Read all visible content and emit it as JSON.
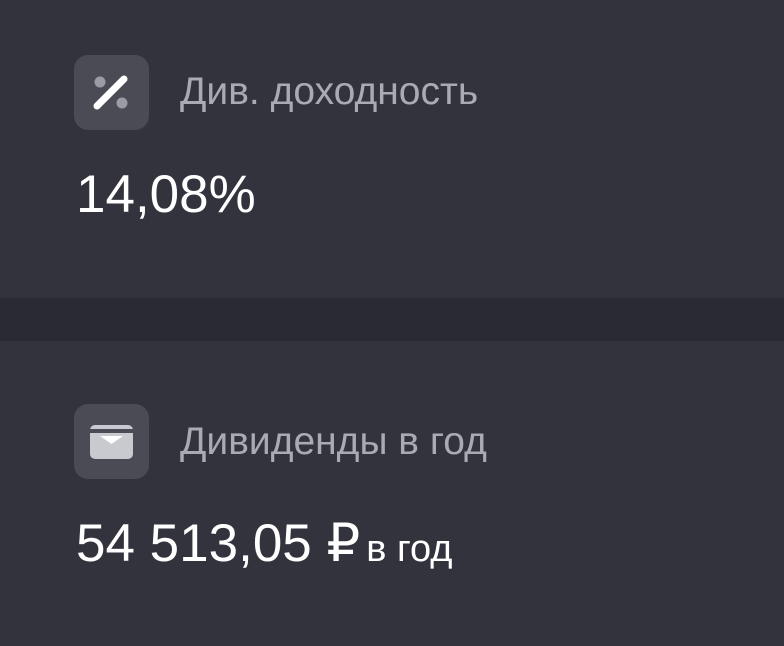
{
  "dividend_yield": {
    "icon": "percent-icon",
    "label": "Див. доходность",
    "value": "14,08%"
  },
  "dividends_per_year": {
    "icon": "wallet-icon",
    "label": "Дивиденды в год",
    "value": "54 513,05 ₽",
    "suffix": "в год"
  },
  "colors": {
    "background": "#2a2a32",
    "card": "#32333d",
    "icon_box": "#4a4b55",
    "label": "#a9aab2",
    "value": "#ffffff"
  }
}
